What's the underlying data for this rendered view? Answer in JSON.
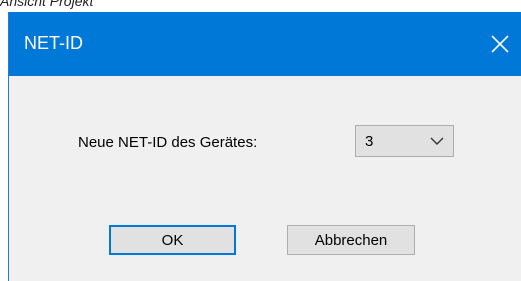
{
  "caption": "Ansicht Projekt",
  "dialog": {
    "title": "NET-ID",
    "close_icon": "close-icon",
    "label": "Neue NET-ID des Gerätes:",
    "select": {
      "value": "3",
      "icon": "chevron-down-icon"
    },
    "buttons": {
      "ok": "OK",
      "cancel": "Abbrechen"
    }
  },
  "colors": {
    "titlebar": "#0078d7",
    "dialog_background": "#f0f0f0",
    "button_background": "#e1e1e1",
    "button_border": "#adadad",
    "default_button_border": "#0078d7"
  }
}
